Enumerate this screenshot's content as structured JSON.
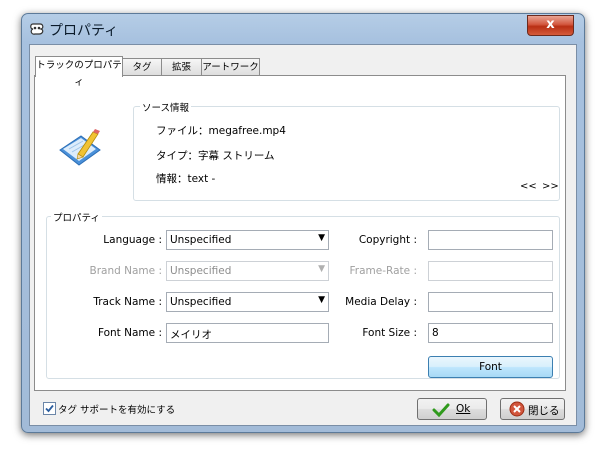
{
  "window": {
    "title": "プロパティ",
    "close_label": "x"
  },
  "tabs": [
    "トラックのプロパティ",
    "タグ",
    "拡張",
    "アートワーク"
  ],
  "source_info": {
    "group_title": "ソース情報",
    "file_line": "ファイル：megafree.mp4",
    "type_line": "タイプ：字幕 ストリーム",
    "info_line": "情報：text -",
    "prev_label": "<<",
    "next_label": ">>"
  },
  "properties": {
    "group_title": "プロパティ",
    "language_label": "Language :",
    "language_value": "Unspecified",
    "brand_name_label": "Brand Name :",
    "brand_name_value": "Unspecified",
    "track_name_label": "Track Name :",
    "track_name_value": "Unspecified",
    "font_name_label": "Font Name :",
    "font_name_value": "メイリオ",
    "copyright_label": "Copyright :",
    "copyright_value": "",
    "frame_rate_label": "Frame-Rate :",
    "frame_rate_value": "",
    "media_delay_label": "Media Delay :",
    "media_delay_value": "",
    "font_size_label": "Font Size :",
    "font_size_value": "8",
    "font_button_label": "Font"
  },
  "footer": {
    "tag_support_label": "タグ サポートを有効にする",
    "tag_support_checked": true,
    "ok_label": "Ok",
    "close_label": "閉じる"
  },
  "colors": {
    "accent": "#3c7fb1",
    "ok_check": "#2f9a1c",
    "close_red": "#d2563d"
  }
}
